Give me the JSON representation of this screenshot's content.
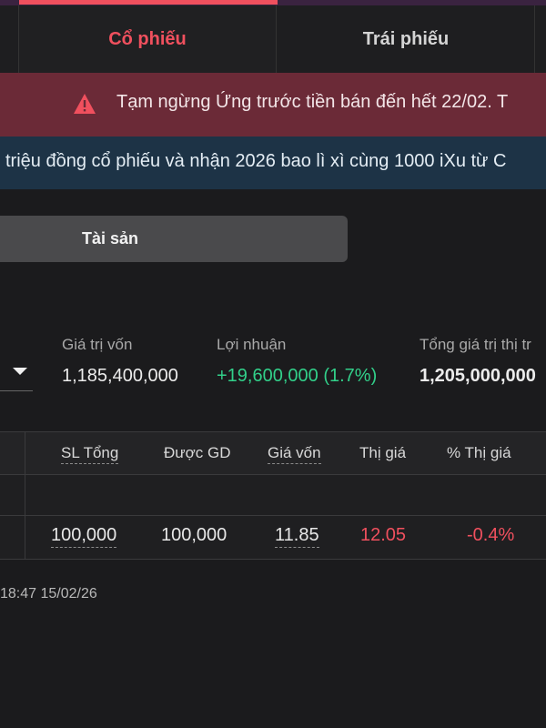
{
  "tabs": [
    {
      "label": "Cổ phiếu",
      "active": true
    },
    {
      "label": "Trái phiếu",
      "active": false
    }
  ],
  "warning": {
    "icon": "warning-triangle-icon",
    "text": "Tạm ngừng Ứng trước tiền bán đến hết 22/02. T"
  },
  "promo": {
    "text": "triệu đồng cổ phiếu và nhận 2026 bao lì xì cùng 1000 iXu từ C"
  },
  "segment": {
    "label": "Tài sản"
  },
  "summary": {
    "cost_value": {
      "label": "Giá trị vốn",
      "value": "1,185,400,000"
    },
    "profit": {
      "label": "Lợi nhuận",
      "value": "+19,600,000 (1.7%)"
    },
    "market_value": {
      "label": "Tổng giá trị thị tr",
      "value": "1,205,000,000"
    }
  },
  "table": {
    "headers": [
      "SL Tổng",
      "Được GD",
      "Giá vốn",
      "Thị giá",
      "% Thị giá"
    ],
    "rows": [
      {
        "total_qty": "100,000",
        "tradable": "100,000",
        "cost_price": "11.85",
        "market_price": "12.05",
        "market_pct": "-0.4%"
      }
    ]
  },
  "timestamp": "18:47 15/02/26",
  "colors": {
    "accent": "#f0505e",
    "profit_green": "#32d08a",
    "warning_bg": "#6b2a37",
    "promo_bg": "#1d3346",
    "background": "#1b1b1d"
  }
}
